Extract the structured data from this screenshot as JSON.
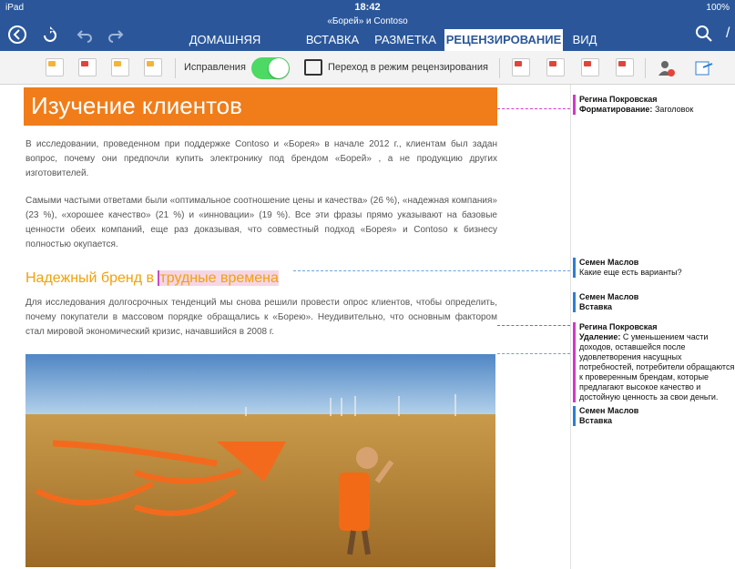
{
  "status": {
    "device": "iPad",
    "time": "18:42",
    "battery": "100%"
  },
  "document": {
    "title": "«Борей» и Contoso"
  },
  "nav": {
    "back": "back",
    "sync": "sync",
    "undo": "undo",
    "redo": "redo"
  },
  "tabs": [
    {
      "label": "ДОМАШНЯЯ СТРАНИЦА"
    },
    {
      "label": "ВСТАВКА"
    },
    {
      "label": "РАЗМЕТКА"
    },
    {
      "label": "РЕЦЕНЗИРОВАНИЕ"
    },
    {
      "label": "ВИД"
    }
  ],
  "toolbar": {
    "track_label": "Исправления",
    "review_mode_label": "Переход в режим рецензирования"
  },
  "body": {
    "heading": "Изучение клиентов",
    "para1": "В исследовании, проведенном при поддержке Contoso и «Борея» в начале 2012 г., клиентам был задан вопрос, почему они предпочли купить электронику под брендом «Борей» , а не продукцию других изготовителей.",
    "para2": "Самыми частыми ответами были «оптимальное соотношение цены и качества» (26 %), «надежная компания» (23 %), «хорошее качество» (21 %) и «инновации» (19 %). Все эти фразы прямо указывают на базовые ценности обеих компаний, еще раз доказывая, что совместный подход «Борея» и Contoso к бизнесу полностью окупается.",
    "subhead_a": "Надежный бренд в ",
    "subhead_b": "трудные времена",
    "para3": "Для исследования долгосрочных тенденций мы снова решили провести опрос клиентов, чтобы определить, почему покупатели в массовом порядке обращались к «Борею». Неудивительно, что основным фактором стал мировой экономический кризис, начавшийся в 2008 г."
  },
  "comments": [
    {
      "author": "Регина Покровская",
      "type_label": "Форматирование:",
      "text": "Заголовок"
    },
    {
      "author": "Семен Маслов",
      "type_label": "",
      "text": "Какие еще есть варианты?"
    },
    {
      "author": "Семен Маслов",
      "type_label": "Вставка",
      "text": ""
    },
    {
      "author": "Регина Покровская",
      "type_label": "Удаление:",
      "text": "С уменьшением части доходов, оставшейся после удовлетворения насущных потребностей, потребители обращаются к проверенным брендам, которые предлагают высокое качество и достойную ценность за свои деньги."
    },
    {
      "author": "Семен Маслов",
      "type_label": "Вставка",
      "text": ""
    }
  ]
}
